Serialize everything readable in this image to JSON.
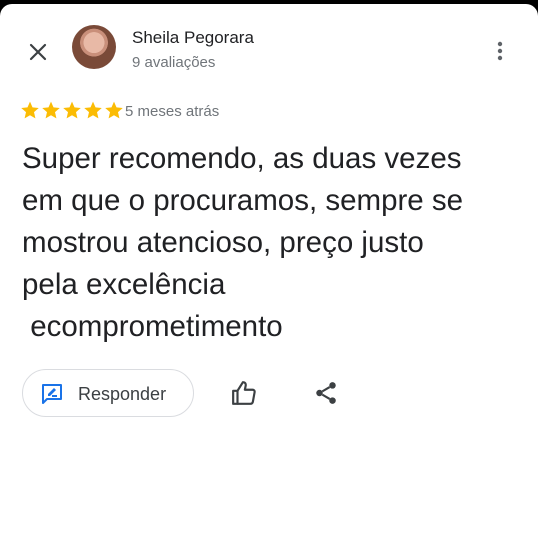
{
  "reviewer": {
    "name": "Sheila Pegorara",
    "reviews_count": "9 avaliações"
  },
  "review": {
    "rating": 5,
    "max_rating": 5,
    "time": "5 meses atrás",
    "text": "Super recomendo, as duas vezes\nem que o procuramos, sempre se\nmostrou atencioso, preço justo\npela excelência\n ecomprometimento"
  },
  "actions": {
    "reply_label": "Responder"
  },
  "icons": {
    "close": "close-icon",
    "menu": "more-vert-icon",
    "reply": "reply-comment-icon",
    "like": "thumb-up-icon",
    "share": "share-icon"
  },
  "colors": {
    "star": "#fbbc04",
    "accent": "#1a73e8",
    "text": "#202124",
    "secondary": "#70757a"
  }
}
